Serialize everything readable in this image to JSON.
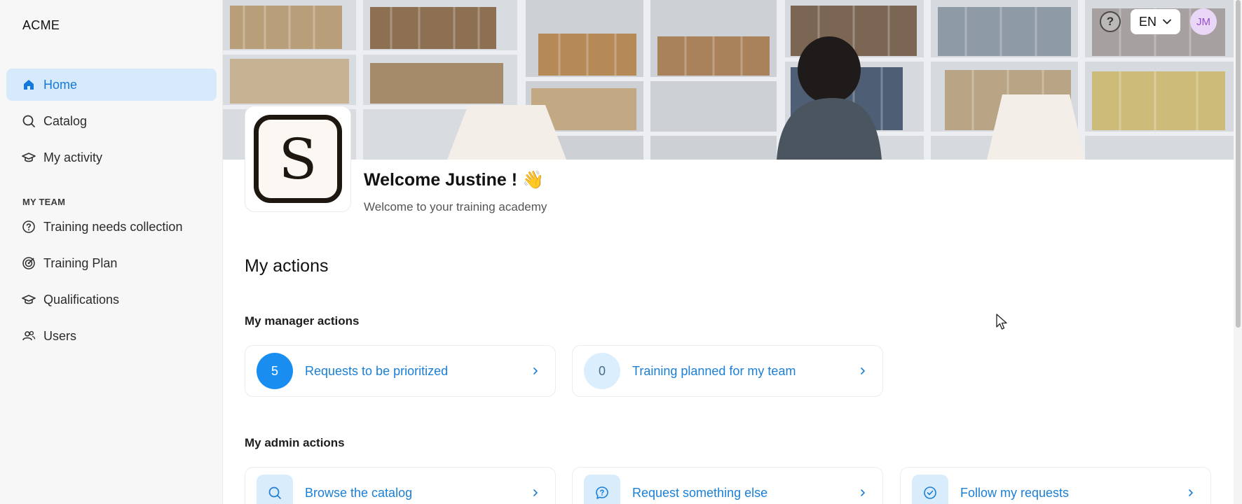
{
  "app": {
    "brand": "ACME"
  },
  "sidebar": {
    "items": [
      {
        "label": "Home",
        "icon": "home-icon"
      },
      {
        "label": "Catalog",
        "icon": "search-icon"
      },
      {
        "label": "My activity",
        "icon": "graduation-cap-icon"
      }
    ],
    "team_section_title": "MY TEAM",
    "team_items": [
      {
        "label": "Training needs collection",
        "icon": "question-circle-icon"
      },
      {
        "label": "Training Plan",
        "icon": "target-icon"
      },
      {
        "label": "Qualifications",
        "icon": "graduation-cap-icon"
      },
      {
        "label": "Users",
        "icon": "users-icon"
      }
    ]
  },
  "topbar": {
    "help_symbol": "?",
    "language": "EN",
    "avatar_initials": "JM"
  },
  "header": {
    "logo_letter": "S",
    "welcome_title": "Welcome Justine ! 👋",
    "welcome_subtitle": "Welcome to your training academy"
  },
  "actions": {
    "title": "My actions",
    "manager_title": "My manager actions",
    "manager_cards": [
      {
        "count": "5",
        "label": "Requests to be prioritized"
      },
      {
        "count": "0",
        "label": "Training planned for my team"
      }
    ],
    "admin_title": "My admin actions",
    "admin_cards": [
      {
        "icon": "search-icon",
        "label": "Browse the catalog"
      },
      {
        "icon": "question-bubble-icon",
        "label": "Request something else"
      },
      {
        "icon": "check-circle-icon",
        "label": "Follow my requests"
      }
    ]
  },
  "colors": {
    "accent": "#1a8ef0",
    "active_bg": "#d6eafc",
    "link": "#1b7fd6"
  }
}
